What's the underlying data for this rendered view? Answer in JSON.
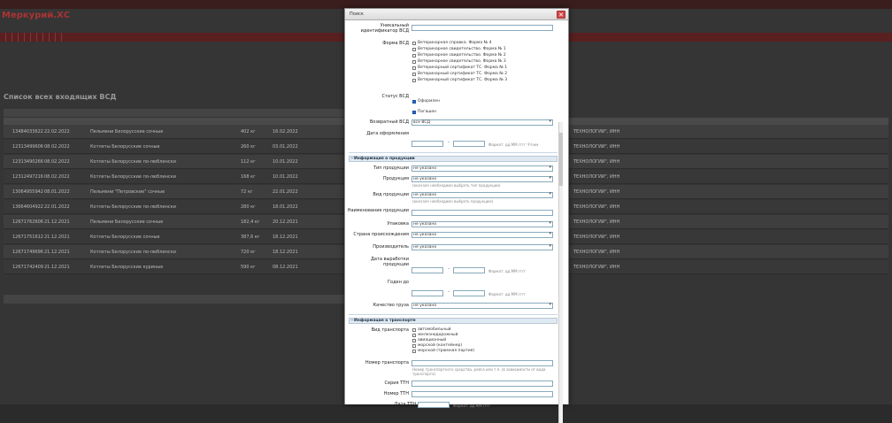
{
  "app": {
    "logo": "Меркурий.ХС"
  },
  "nav": {
    "items": [
      "",
      "",
      "",
      "",
      "",
      "",
      "",
      "",
      "",
      ""
    ]
  },
  "list": {
    "heading": "Список всех входящих ВСД",
    "rows": [
      {
        "num": "13484033622",
        "date": "22.02.2022",
        "name": "Пельмени Белорусские сочные",
        "qty": "402 кг",
        "prod": "16.02.2022"
      },
      {
        "num": "12313499606",
        "date": "08.02.2022",
        "name": "Котлеты Белорусские сочные",
        "qty": "260 кг",
        "prod": "03.01.2022"
      },
      {
        "num": "12313490266",
        "date": "08.02.2022",
        "name": "Котлеты Белорусские по-люблински",
        "qty": "112 кг",
        "prod": "10.01.2022"
      },
      {
        "num": "12312497216",
        "date": "08.02.2022",
        "name": "Котлеты Белорусские по-люблински",
        "qty": "168 кг",
        "prod": "10.01.2022"
      },
      {
        "num": "13064955942",
        "date": "08.01.2022",
        "name": "Пельмени \"Петровские\" сочные",
        "qty": "72 кг",
        "prod": "22.01.2022"
      },
      {
        "num": "13664604922",
        "date": "22.01.2022",
        "name": "Котлеты Белорусские по-люблински",
        "qty": "280 кг",
        "prod": "18.01.2022"
      },
      {
        "num": "12671762606",
        "date": "21.12.2021",
        "name": "Пельмени Белорусские сочные",
        "qty": "182,4 кг",
        "prod": "20.12.2021"
      },
      {
        "num": "12671751612",
        "date": "21.12.2021",
        "name": "Котлеты Белорусские сочные",
        "qty": "387,6 кг",
        "prod": "18.12.2021"
      },
      {
        "num": "12671749696",
        "date": "21.12.2021",
        "name": "Котлеты Белорусские по-люблински",
        "qty": "720 кг",
        "prod": "18.12.2021"
      },
      {
        "num": "12671742409",
        "date": "21.12.2021",
        "name": "Котлеты Белорусские куриные",
        "qty": "590 кг",
        "prod": "08.12.2021"
      }
    ],
    "right_rows": [
      "ТЕХНОЛОГИИ\", ИНН",
      "ТЕХНОЛОГИИ\", ИНН",
      "ТЕХНОЛОГИИ\", ИНН",
      "ТЕХНОЛОГИИ\", ИНН",
      "ТЕХНОЛОГИИ\", ИНН",
      "ТЕХНОЛОГИИ\", ИНН",
      "ТЕХНОЛОГИИ\", ИНН",
      "ТЕХНОЛОГИИ\", ИНН",
      "ТЕХНОЛОГИИ\", ИНН",
      "ТЕХНОЛОГИИ\", ИНН"
    ]
  },
  "dialog": {
    "title": "Поиск",
    "uid_label": "Уникальный идентификатор ВСД",
    "form_label": "Форма ВСД",
    "forms": [
      "Ветеринарная справка. Форма № 4",
      "Ветеринарное свидетельство. Форма № 1",
      "Ветеринарное свидетельство. Форма № 2",
      "Ветеринарное свидетельство. Форма № 3",
      "Ветеринарный сертификат ТС. Форма № 1",
      "Ветеринарный сертификат ТС. Форма № 2",
      "Ветеринарный сертификат ТС. Форма № 3"
    ],
    "status_label": "Статус ВСД",
    "statuses": [
      {
        "label": "Оформлен",
        "checked": true
      },
      {
        "label": "Погашен",
        "checked": true
      }
    ],
    "returned_label": "Возвратный ВСД",
    "returned_value": "все ВСД",
    "date_label": "Дата оформления",
    "hint_date": "Формат: дд.ММ.гггг ЧЧ:мм",
    "product_section": "Информация о продукции",
    "product_type_label": "Тип продукции",
    "product_label": "Продукция",
    "hint_choose_type": "(вначале необходимо выбрать тип продукции)",
    "kind_label": "Вид продукции",
    "hint_choose_product": "(вначале необходимо выбрать продукцию)",
    "name_label": "Наименование продукции",
    "package_label": "Упаковка",
    "country_label": "Страна происхождения",
    "producer_label": "Производитель",
    "mfg_label": "Дата выработки продукции",
    "hint_fmt": "Формат: дд.ММ.гггг",
    "expiry_label": "Годен до",
    "quality_label": "Качество груза",
    "not_specified": "не указано",
    "transport_section": "Информация о транспорте",
    "vehicle_label": "Вид транспорта",
    "vehicles": [
      "автомобильный",
      "железнодорожный",
      "авиационный",
      "морской (контейнер)",
      "морской (трюмная партия)"
    ],
    "tn_label": "Номер транспорта",
    "hint_tn": "Номер транспортного средства, рейса или т.п. (в зависимости от вида транспорта)",
    "ttn_series_label": "Серия ТТН",
    "ttn_num_label": "Номер ТТН",
    "ttn_date_label": "Дата ТТН"
  }
}
